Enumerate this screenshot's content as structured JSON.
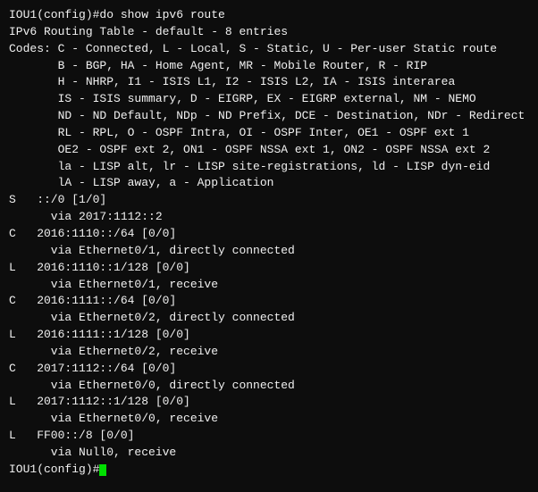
{
  "terminal": {
    "lines": [
      {
        "id": "line-01",
        "text": "IOU1(config)#do show ipv6 route"
      },
      {
        "id": "line-02",
        "text": "IPv6 Routing Table - default - 8 entries"
      },
      {
        "id": "line-03",
        "text": "Codes: C - Connected, L - Local, S - Static, U - Per-user Static route"
      },
      {
        "id": "line-04",
        "text": "       B - BGP, HA - Home Agent, MR - Mobile Router, R - RIP"
      },
      {
        "id": "line-05",
        "text": "       H - NHRP, I1 - ISIS L1, I2 - ISIS L2, IA - ISIS interarea"
      },
      {
        "id": "line-06",
        "text": "       IS - ISIS summary, D - EIGRP, EX - EIGRP external, NM - NEMO"
      },
      {
        "id": "line-07",
        "text": "       ND - ND Default, NDp - ND Prefix, DCE - Destination, NDr - Redirect"
      },
      {
        "id": "line-08",
        "text": "       RL - RPL, O - OSPF Intra, OI - OSPF Inter, OE1 - OSPF ext 1"
      },
      {
        "id": "line-09",
        "text": "       OE2 - OSPF ext 2, ON1 - OSPF NSSA ext 1, ON2 - OSPF NSSA ext 2"
      },
      {
        "id": "line-10",
        "text": "       la - LISP alt, lr - LISP site-registrations, ld - LISP dyn-eid"
      },
      {
        "id": "line-11",
        "text": "       lA - LISP away, a - Application"
      },
      {
        "id": "line-12",
        "text": "S   ::/0 [1/0]"
      },
      {
        "id": "line-13",
        "text": "      via 2017:1112::2"
      },
      {
        "id": "line-14",
        "text": "C   2016:1110::/64 [0/0]"
      },
      {
        "id": "line-15",
        "text": "      via Ethernet0/1, directly connected"
      },
      {
        "id": "line-16",
        "text": "L   2016:1110::1/128 [0/0]"
      },
      {
        "id": "line-17",
        "text": "      via Ethernet0/1, receive"
      },
      {
        "id": "line-18",
        "text": "C   2016:1111::/64 [0/0]"
      },
      {
        "id": "line-19",
        "text": "      via Ethernet0/2, directly connected"
      },
      {
        "id": "line-20",
        "text": "L   2016:1111::1/128 [0/0]"
      },
      {
        "id": "line-21",
        "text": "      via Ethernet0/2, receive"
      },
      {
        "id": "line-22",
        "text": "C   2017:1112::/64 [0/0]"
      },
      {
        "id": "line-23",
        "text": "      via Ethernet0/0, directly connected"
      },
      {
        "id": "line-24",
        "text": "L   2017:1112::1/128 [0/0]"
      },
      {
        "id": "line-25",
        "text": "      via Ethernet0/0, receive"
      },
      {
        "id": "line-26",
        "text": "L   FF00::/8 [0/0]"
      },
      {
        "id": "line-27",
        "text": "      via Null0, receive"
      },
      {
        "id": "line-28",
        "text": "IOU1(config)#"
      }
    ]
  }
}
